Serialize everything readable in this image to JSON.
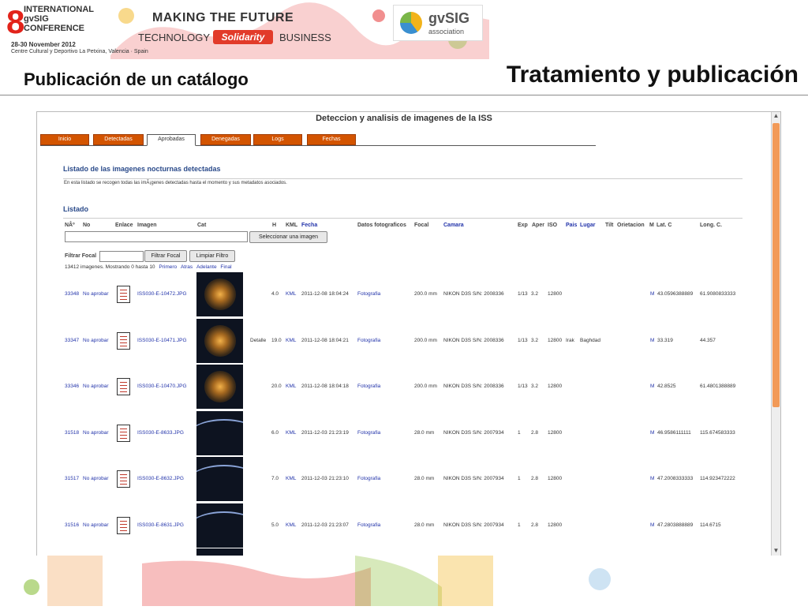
{
  "conference": {
    "number": "8",
    "lines": "INTERNATIONAL\ngvSIG\nCONFERENCE",
    "dates": "28-30 November 2012",
    "venue": "Centre Cultural y Deportivo La Petxina, Valencia · Spain",
    "slogan_top": "MAKING THE FUTURE",
    "slogan_left": "TECHNOLOGY",
    "slogan_mid": "Solidarity",
    "slogan_right": "BUSINESS",
    "logo_name": "gvSIG",
    "logo_sub": "association"
  },
  "slide": {
    "title": "Tratamiento y publicación",
    "subtitle": "Publicación de un catálogo"
  },
  "app": {
    "title": "Deteccion y analisis de imagenes de la ISS",
    "tabs": [
      "Inicio",
      "Detectadas",
      "Aprobadas",
      "Denegadas",
      "Logs",
      "Fechas"
    ],
    "active_tab": "Aprobadas",
    "section_title": "Listado de las imagenes nocturnas detectadas",
    "section_text": "En esta listado se recogen todas las imÃ¡genes detectadas hasta el momento y sus metadatos asociados.",
    "list_title": "Listado",
    "headers": {
      "na": "NÂº",
      "no": "No",
      "enlace": "Enlace",
      "imagen": "Imagen",
      "cat": "Cat",
      "h": "H",
      "kml": "KML",
      "fecha": "Fecha",
      "datos": "Datos fotograficos",
      "focal": "Focal",
      "camara": "Camara",
      "exp": "Exp",
      "aper": "Aper",
      "iso": "ISO",
      "pais": "Pais",
      "lugar": "Lugar",
      "tilt": "Tilt",
      "orient": "Orietacion",
      "m": "M",
      "lat": "Lat. C",
      "long": "Long. C."
    },
    "select_button": "Seleccionar una imagen",
    "filter_label": "Filtrar Focal",
    "filter_button": "Filtrar Focal",
    "clear_button": "Limpiar Filtro",
    "count_text": "13412   imagenes. Mostrando 0 hasta 10",
    "pager": [
      "Primero",
      "Atras",
      "Adelante",
      "Final"
    ],
    "rows": [
      {
        "id": "33348",
        "action": "No aprobar",
        "file": "ISS030-E-10472.JPG",
        "cat": "",
        "h": "4.0",
        "kml": "KML",
        "date": "2011-12-08 18:04:24",
        "datos": "Fotografia",
        "focal": "200.0 mm",
        "camera": "NIKON D3S S/N: 2008336",
        "exp": "1/13",
        "aper": "3.2",
        "iso": "12800",
        "pais": "",
        "lugar": "",
        "m": "M",
        "lat": "43.0596388889",
        "lon": "61.9080833333",
        "img": "city"
      },
      {
        "id": "33347",
        "action": "No aprobar",
        "file": "ISS030-E-10471.JPG",
        "cat": "Detalle",
        "h": "19.0",
        "kml": "KML",
        "date": "2011-12-08 18:04:21",
        "datos": "Fotografia",
        "focal": "200.0 mm",
        "camera": "NIKON D3S S/N: 2008336",
        "exp": "1/13",
        "aper": "3.2",
        "iso": "12800",
        "pais": "Irak",
        "lugar": "Baghdad",
        "m": "M",
        "lat": "33.319",
        "lon": "44.357",
        "img": "city"
      },
      {
        "id": "33346",
        "action": "No aprobar",
        "file": "ISS030-E-10470.JPG",
        "cat": "",
        "h": "20.0",
        "kml": "KML",
        "date": "2011-12-08 18:04:18",
        "datos": "Fotografia",
        "focal": "200.0 mm",
        "camera": "NIKON D3S S/N: 2008336",
        "exp": "1/13",
        "aper": "3.2",
        "iso": "12800",
        "pais": "",
        "lugar": "",
        "m": "M",
        "lat": "42.8525",
        "lon": "61.4801388889",
        "img": "city"
      },
      {
        "id": "31518",
        "action": "No aprobar",
        "file": "ISS030-E-8633.JPG",
        "cat": "",
        "h": "6.0",
        "kml": "KML",
        "date": "2011-12-03 21:23:19",
        "datos": "Fotografia",
        "focal": "28.0 mm",
        "camera": "NIKON D3S S/N: 2007934",
        "exp": "1",
        "aper": "2.8",
        "iso": "12800",
        "pais": "",
        "lugar": "",
        "m": "M",
        "lat": "46.9586111111",
        "lon": "115.674583333",
        "img": "horizon"
      },
      {
        "id": "31517",
        "action": "No aprobar",
        "file": "ISS030-E-8632.JPG",
        "cat": "",
        "h": "7.0",
        "kml": "KML",
        "date": "2011-12-03 21:23:10",
        "datos": "Fotografia",
        "focal": "28.0 mm",
        "camera": "NIKON D3S S/N: 2007934",
        "exp": "1",
        "aper": "2.8",
        "iso": "12800",
        "pais": "",
        "lugar": "",
        "m": "M",
        "lat": "47.2008333333",
        "lon": "114.923472222",
        "img": "horizon"
      },
      {
        "id": "31516",
        "action": "No aprobar",
        "file": "ISS030-E-8631.JPG",
        "cat": "",
        "h": "5.0",
        "kml": "KML",
        "date": "2011-12-03 21:23:07",
        "datos": "Fotografia",
        "focal": "28.0 mm",
        "camera": "NIKON D3S S/N: 2007934",
        "exp": "1",
        "aper": "2.8",
        "iso": "12800",
        "pais": "",
        "lugar": "",
        "m": "M",
        "lat": "47.2803888889",
        "lon": "114.6715",
        "img": "horizon"
      }
    ]
  },
  "colors": {
    "accent": "#d35400",
    "link": "#2233aa",
    "scroll": "#f29a58",
    "brand_red": "#e2231a"
  }
}
